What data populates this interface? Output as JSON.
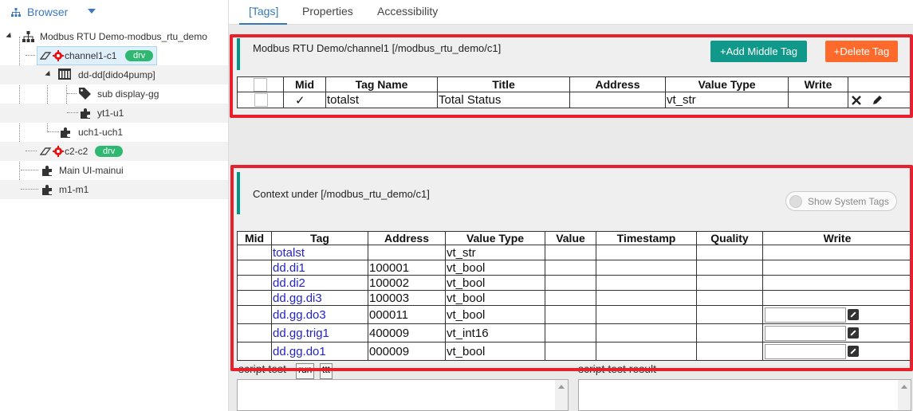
{
  "sidebar": {
    "title": "Browser",
    "tree": [
      {
        "label": "Modbus RTU Demo-modbus_rtu_demo"
      },
      {
        "label": "channel1-c1",
        "badge": "drv"
      },
      {
        "label": "dd-dd[dido4pump]"
      },
      {
        "label": "sub display-gg"
      },
      {
        "label": "yt1-u1"
      },
      {
        "label": "uch1-uch1"
      },
      {
        "label": "c2-c2",
        "badge": "drv"
      },
      {
        "label": "Main UI-mainui"
      },
      {
        "label": "m1-m1"
      }
    ]
  },
  "tabs": [
    {
      "label": "[Tags]",
      "active": true
    },
    {
      "label": "Properties"
    },
    {
      "label": "Accessibility"
    }
  ],
  "tags_panel": {
    "title": "Modbus RTU Demo/channel1 [/modbus_rtu_demo/c1]",
    "add_button": "+Add Middle Tag",
    "delete_button": "+Delete Tag",
    "add_color": "#10998a",
    "delete_color": "#fd6a2c",
    "columns": [
      "",
      "Mid",
      "Tag Name",
      "Title",
      "Address",
      "Value Type",
      "Write",
      ""
    ],
    "rows": [
      {
        "mid": "✓",
        "tag_name": "totalst",
        "title": "Total Status",
        "address": "",
        "value_type": "vt_str",
        "write": ""
      }
    ]
  },
  "context_panel": {
    "title": "Context under [/modbus_rtu_demo/c1]",
    "toggle_label": "Show System Tags",
    "columns": [
      "Mid",
      "Tag",
      "Address",
      "Value Type",
      "Value",
      "Timestamp",
      "Quality",
      "Write"
    ],
    "rows": [
      {
        "mid": "",
        "tag": "totalst",
        "address": "",
        "value_type": "vt_str",
        "value": "",
        "timestamp": "",
        "quality": "",
        "writable": false
      },
      {
        "mid": "",
        "tag": "dd.di1",
        "address": "100001",
        "value_type": "vt_bool",
        "value": "",
        "timestamp": "",
        "quality": "",
        "writable": false
      },
      {
        "mid": "",
        "tag": "dd.di2",
        "address": "100002",
        "value_type": "vt_bool",
        "value": "",
        "timestamp": "",
        "quality": "",
        "writable": false
      },
      {
        "mid": "",
        "tag": "dd.gg.di3",
        "address": "100003",
        "value_type": "vt_bool",
        "value": "",
        "timestamp": "",
        "quality": "",
        "writable": false
      },
      {
        "mid": "",
        "tag": "dd.gg.do3",
        "address": "000011",
        "value_type": "vt_bool",
        "value": "",
        "timestamp": "",
        "quality": "",
        "writable": true
      },
      {
        "mid": "",
        "tag": "dd.gg.trig1",
        "address": "400009",
        "value_type": "vt_int16",
        "value": "",
        "timestamp": "",
        "quality": "",
        "writable": true
      },
      {
        "mid": "",
        "tag": "dd.gg.do1",
        "address": "000009",
        "value_type": "vt_bool",
        "value": "",
        "timestamp": "",
        "quality": "",
        "writable": true
      }
    ]
  },
  "script": {
    "test_label": "script test",
    "run_button": "run",
    "ttt_button": "ttt",
    "result_label": "script test result"
  },
  "colors": {
    "highlight_frame": "#e8202b",
    "accent": "#009688",
    "link": "#2424c8",
    "badge": "#2eb872"
  }
}
